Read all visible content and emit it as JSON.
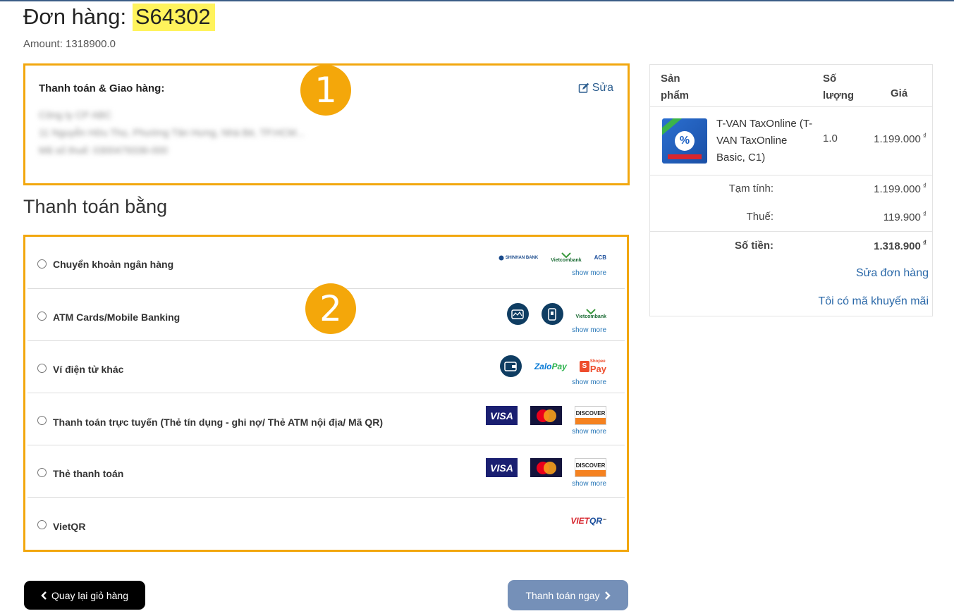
{
  "order": {
    "title_prefix": "Đơn hàng:",
    "code": "S64302",
    "amount": "Amount: 1318900.0"
  },
  "billing": {
    "title": "Thanh toán & Giao hàng:",
    "edit_label": "Sửa",
    "lines": [
      "Công ty CP ABC",
      "11 Nguyễn Hữu Thọ, Phường Tân Hưng, Nhà Bè, TP.HCM...",
      "Mã số thuế: 0300479336-000"
    ]
  },
  "badges": {
    "one": "1",
    "two": "2"
  },
  "payment": {
    "heading": "Thanh toán bằng",
    "show_more": "show more",
    "methods": [
      {
        "label": "Chuyển khoản ngân hàng",
        "logos": [
          "SHINHAN BANK",
          "Vietcombank",
          "ACB"
        ]
      },
      {
        "label": "ATM Cards/Mobile Banking",
        "logos": [
          "atm-card-icon",
          "mobile-banking-icon",
          "Vietcombank"
        ]
      },
      {
        "label": "Ví điện tử khác",
        "logos": [
          "wallet-icon",
          "ZaloPay",
          "ShopeePay"
        ]
      },
      {
        "label": "Thanh toán trực tuyến (Thẻ tín dụng - ghi nợ/ Thẻ ATM nội địa/ Mã QR)",
        "logos": [
          "VISA",
          "MasterCard",
          "DISCOVER"
        ]
      },
      {
        "label": "Thẻ thanh toán",
        "logos": [
          "VISA",
          "MasterCard",
          "DISCOVER"
        ]
      },
      {
        "label": "VietQR",
        "logos": [
          "VIETQR"
        ]
      }
    ],
    "zalo": {
      "zalo": "Zalo",
      "pay": "Pay"
    },
    "shopee": {
      "top": "Shopee",
      "pay": "Pay",
      "mark": "S"
    },
    "vietqr": {
      "viet": "VIET",
      "qr": "QR",
      "tm": "™"
    }
  },
  "buttons": {
    "back": "Quay lại giỏ hàng",
    "pay_now": "Thanh toán ngay"
  },
  "summary": {
    "col_product": "Sản phẩm",
    "col_qty": "Số lượng",
    "col_price": "Giá",
    "product": {
      "name": "T-VAN TaxOnline (T-VAN TaxOnline Basic, C1)",
      "qty": "1.0",
      "price": "1.199.000"
    },
    "currency": "₫",
    "subtotal_label": "Tạm tính:",
    "subtotal_value": "1.199.000",
    "tax_label": "Thuế:",
    "tax_value": "119.900",
    "total_label": "Số tiền:",
    "total_value": "1.318.900",
    "edit_order": "Sửa đơn hàng",
    "promo": "Tôi có mã khuyến mãi"
  },
  "colors": {
    "highlight": "#fff35c",
    "box_border": "#f2a70e",
    "badge": "#f4a70a",
    "link": "#2a68a8",
    "pay_button": "#7590b8",
    "back_button": "#000000"
  }
}
